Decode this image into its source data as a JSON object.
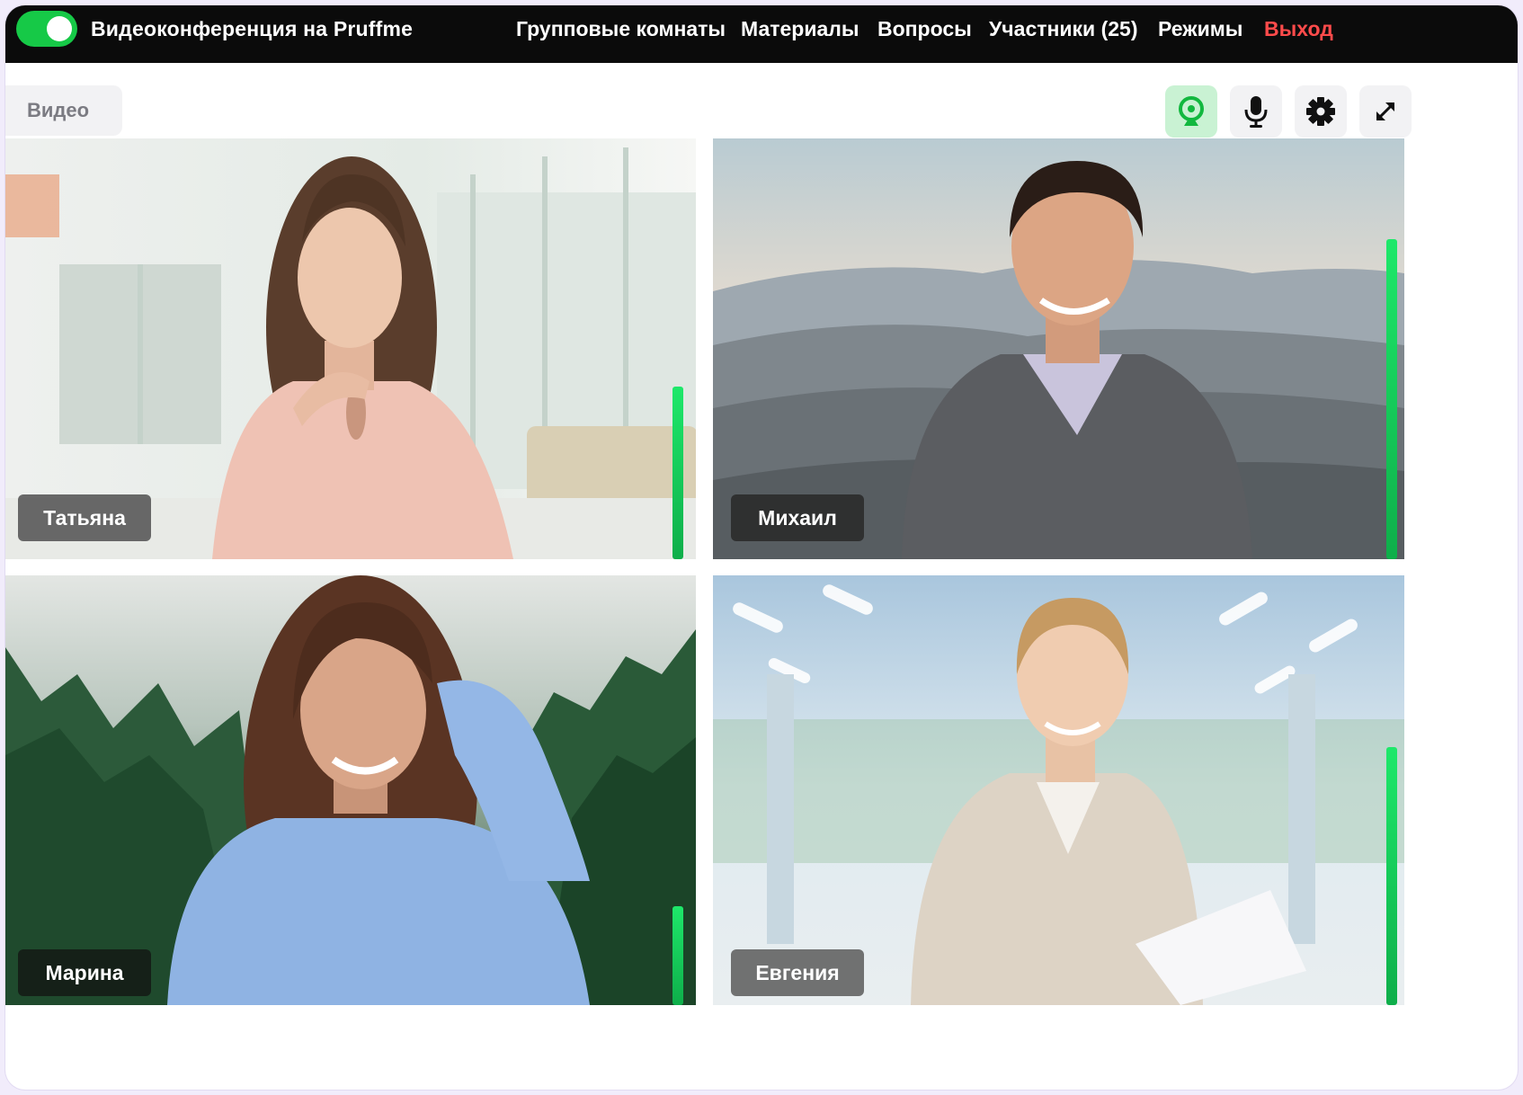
{
  "app": {
    "title": "Видеоконференция на Pruffme",
    "toggle_on": true
  },
  "nav": {
    "items": [
      "Групповые комнаты",
      "Материалы",
      "Вопросы",
      "Участники (25)",
      "Режимы"
    ],
    "exit": "Выход"
  },
  "toolbar": {
    "tab_label": "Видео",
    "buttons": [
      {
        "icon": "webcam-icon",
        "active": true
      },
      {
        "icon": "microphone-icon",
        "active": false
      },
      {
        "icon": "gear-icon",
        "active": false
      },
      {
        "icon": "fullscreen-icon",
        "active": false
      }
    ]
  },
  "participants": [
    {
      "name": "Татьяна",
      "audio_level": 0.41
    },
    {
      "name": "Михаил",
      "audio_level": 0.76
    },
    {
      "name": "Марина",
      "audio_level": 0.23
    },
    {
      "name": "Евгения",
      "audio_level": 0.6
    }
  ],
  "colors": {
    "accent": "#16c947",
    "exit": "#ff4b4b",
    "active_tool_bg": "#c9f2d3"
  }
}
